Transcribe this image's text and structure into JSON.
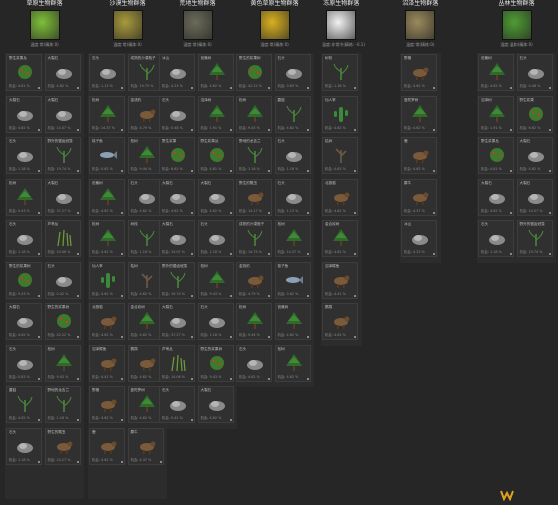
{
  "biomes": [
    {
      "title": "草原生物群落",
      "temp": "温度:常(精炼:0)",
      "color": "#7fbf3a"
    },
    {
      "title": "沙漠生物群落",
      "temp": "温度:常(精炼:0)",
      "color": "#a89a3c"
    },
    {
      "title": "荒地生物群落",
      "temp": "温度:常(精炼:0)",
      "color": "#6b6b5a"
    },
    {
      "title": "黄色草原生物群落",
      "temp": "温度:常(精炼:0)",
      "color": "#d8b021"
    },
    {
      "title": "冻原生物群落",
      "temp": "温度:非常冷(精炼: -0.1)",
      "color": "#f2f2f2"
    },
    {
      "title": "沼泽生物群落",
      "temp": "温度:常(精炼:0)",
      "color": "#9b8a5c"
    },
    {
      "title": "丛林生物群落",
      "temp": "温度:温和(精炼:0)",
      "color": "#4f9c33"
    }
  ],
  "cells": [
    {
      "n": "野生浆果丛",
      "f": "机会: 4.81 %",
      "i": "bush"
    },
    {
      "n": "大裂石",
      "f": "机会: 4.62 %",
      "i": "rock"
    },
    {
      "n": "大裂石",
      "f": "机会: 4.62 %",
      "i": "rock"
    },
    {
      "n": "大裂石",
      "f": "机会: 14.07 %",
      "i": "rock"
    },
    {
      "n": "石头",
      "f": "机会: 1.18 %",
      "i": "rock"
    },
    {
      "n": "野外的锯齿冠藻",
      "f": "机会: 19.74 %",
      "i": "plant"
    },
    {
      "n": "松树",
      "f": "机会: 9.43 %",
      "i": "tree"
    },
    {
      "n": "大裂石",
      "f": "机会: 37.27 %",
      "i": "rock"
    },
    {
      "n": "石头",
      "f": "机会: 1.18 %",
      "i": "rock"
    },
    {
      "n": "芦苇丛",
      "f": "机会: 14.06 %",
      "i": "grass"
    },
    {
      "n": "野生的浆果树",
      "f": "机会: 9.43 %",
      "i": "bush"
    },
    {
      "n": "石头",
      "f": "机会: 0.42 %",
      "i": "rock"
    },
    {
      "n": "大裂石",
      "f": "机会: 4.62 %",
      "i": "rock"
    },
    {
      "n": "野生的浆果树",
      "f": "机会: 42.22 %",
      "i": "bush"
    },
    {
      "n": "石头",
      "f": "机会: 0.83 %",
      "i": "rock"
    },
    {
      "n": "松树",
      "f": "机会: 9.43 %",
      "i": "tree"
    },
    {
      "n": "蘑菇",
      "f": "机会: 4.62 %",
      "i": "plant"
    },
    {
      "n": "野地的龙舌兰",
      "f": "机会: 1.18 %",
      "i": "plant"
    },
    {
      "n": "石头",
      "f": "机会: 1.18 %",
      "i": "rock"
    },
    {
      "n": "野生的瓢虫",
      "f": "机会: 14.27 %",
      "i": "animal"
    },
    {
      "n": "石头",
      "f": "机会: 1.13 %",
      "i": "rock"
    },
    {
      "n": "成熟的沙漠瓶子",
      "f": "机会: 14.75 %",
      "i": "plant"
    },
    {
      "n": "松树",
      "f": "机会: 14.37 %",
      "i": "tree"
    },
    {
      "n": "金钱豹",
      "f": "机会: 4.79 %",
      "i": "animal"
    },
    {
      "n": "梭子鱼",
      "f": "机会: 0.62 %",
      "i": "fish"
    },
    {
      "n": "松树",
      "f": "机会: 9.44 %",
      "i": "tree"
    },
    {
      "n": "芭蕉树",
      "f": "机会: 4.62 %",
      "i": "tree"
    },
    {
      "n": "石头",
      "f": "机会: 4.62 %",
      "i": "rock"
    },
    {
      "n": "松树",
      "f": "机会: 4.62 %",
      "i": "tree"
    },
    {
      "n": "树枝",
      "f": "机会: 1.18 %",
      "i": "plant"
    },
    {
      "n": "仙人掌",
      "f": "机会: 4.62 %",
      "i": "cactus"
    },
    {
      "n": "枯树",
      "f": "机会: 4.62 %",
      "i": "deadtree"
    },
    {
      "n": "北极狐",
      "f": "机会: 4.62 %",
      "i": "animal"
    },
    {
      "n": "金合欢树",
      "f": "机会: 4.62 %",
      "i": "tree"
    },
    {
      "n": "沼泽鳄鱼",
      "f": "机会: 4.41 %",
      "i": "animal"
    },
    {
      "n": "鹦鹉",
      "f": "机会: 4.62 %",
      "i": "animal"
    },
    {
      "n": "野猪",
      "f": "机会: 4.62 %",
      "i": "animal"
    },
    {
      "n": "曼陀罗树",
      "f": "机会: 4.62 %",
      "i": "tree"
    },
    {
      "n": "鹿",
      "f": "机会: 4.62 %",
      "i": "animal"
    },
    {
      "n": "麝牛",
      "f": "机会: 4.37 %",
      "i": "animal"
    },
    {
      "n": "冰山",
      "f": "机会: 4.23 %",
      "i": "rock"
    },
    {
      "n": "芭蕉树",
      "f": "机会: 4.62 %",
      "i": "tree"
    },
    {
      "n": "石头",
      "f": "机会: 0.48 %",
      "i": "rock"
    },
    {
      "n": "沼泽树",
      "f": "机会: 1.91 %",
      "i": "tree"
    },
    {
      "n": "野生浆果",
      "f": "机会: 6.62 %",
      "i": "bush"
    }
  ],
  "watermark": "W"
}
